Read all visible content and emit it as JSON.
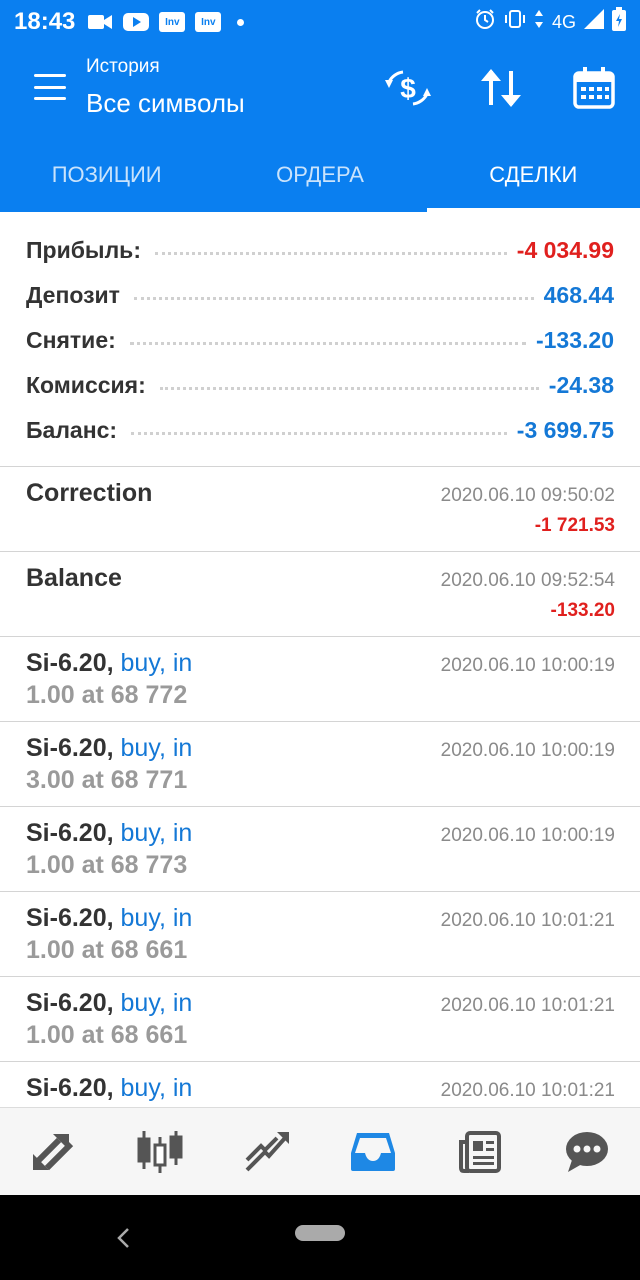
{
  "status_bar": {
    "time": "18:43",
    "network": "4G",
    "notification_icons": [
      "video-icon",
      "youtube-icon",
      "inv-icon",
      "inv-icon"
    ],
    "inv_label": "Inv"
  },
  "app_bar": {
    "subtitle": "История",
    "title": "Все символы"
  },
  "tabs": [
    {
      "label": "ПОЗИЦИИ",
      "active": false
    },
    {
      "label": "ОРДЕРА",
      "active": false
    },
    {
      "label": "СДЕЛКИ",
      "active": true
    }
  ],
  "summary": [
    {
      "label": "Прибыль:",
      "value": "-4 034.99",
      "color": "#e0201e"
    },
    {
      "label": "Депозит",
      "value": "468.44",
      "color": "#1478d6"
    },
    {
      "label": "Снятие:",
      "value": "-133.20",
      "color": "#1478d6"
    },
    {
      "label": "Комиссия:",
      "value": "-24.38",
      "color": "#1478d6"
    },
    {
      "label": "Баланс:",
      "value": "-3 699.75",
      "color": "#1478d6"
    }
  ],
  "deals": [
    {
      "name": "Correction",
      "type": "",
      "detail": "",
      "time": "2020.06.10 09:50:02",
      "profit": "-1 721.53"
    },
    {
      "name": "Balance",
      "type": "",
      "detail": "",
      "time": "2020.06.10 09:52:54",
      "profit": "-133.20"
    },
    {
      "name": "Si-6.20,",
      "type": "buy, in",
      "detail": "1.00 at 68 772",
      "time": "2020.06.10 10:00:19",
      "profit": ""
    },
    {
      "name": "Si-6.20,",
      "type": "buy, in",
      "detail": "3.00 at 68 771",
      "time": "2020.06.10 10:00:19",
      "profit": ""
    },
    {
      "name": "Si-6.20,",
      "type": "buy, in",
      "detail": "1.00 at 68 773",
      "time": "2020.06.10 10:00:19",
      "profit": ""
    },
    {
      "name": "Si-6.20,",
      "type": "buy, in",
      "detail": "1.00 at 68 661",
      "time": "2020.06.10 10:01:21",
      "profit": ""
    },
    {
      "name": "Si-6.20,",
      "type": "buy, in",
      "detail": "1.00 at 68 661",
      "time": "2020.06.10 10:01:21",
      "profit": ""
    },
    {
      "name": "Si-6.20,",
      "type": "buy, in",
      "detail": "",
      "time": "2020.06.10 10:01:21",
      "profit": ""
    }
  ],
  "bottom_nav": [
    {
      "icon": "quotes-icon",
      "active": false
    },
    {
      "icon": "candlestick-chart-icon",
      "active": false
    },
    {
      "icon": "trade-icon",
      "active": false
    },
    {
      "icon": "history-inbox-icon",
      "active": true
    },
    {
      "icon": "news-icon",
      "active": false
    },
    {
      "icon": "chat-icon",
      "active": false
    }
  ],
  "colors": {
    "primary": "#0a7ff0",
    "loss_red": "#e0201e",
    "value_blue": "#1478d6",
    "nav_inactive": "#555555"
  }
}
